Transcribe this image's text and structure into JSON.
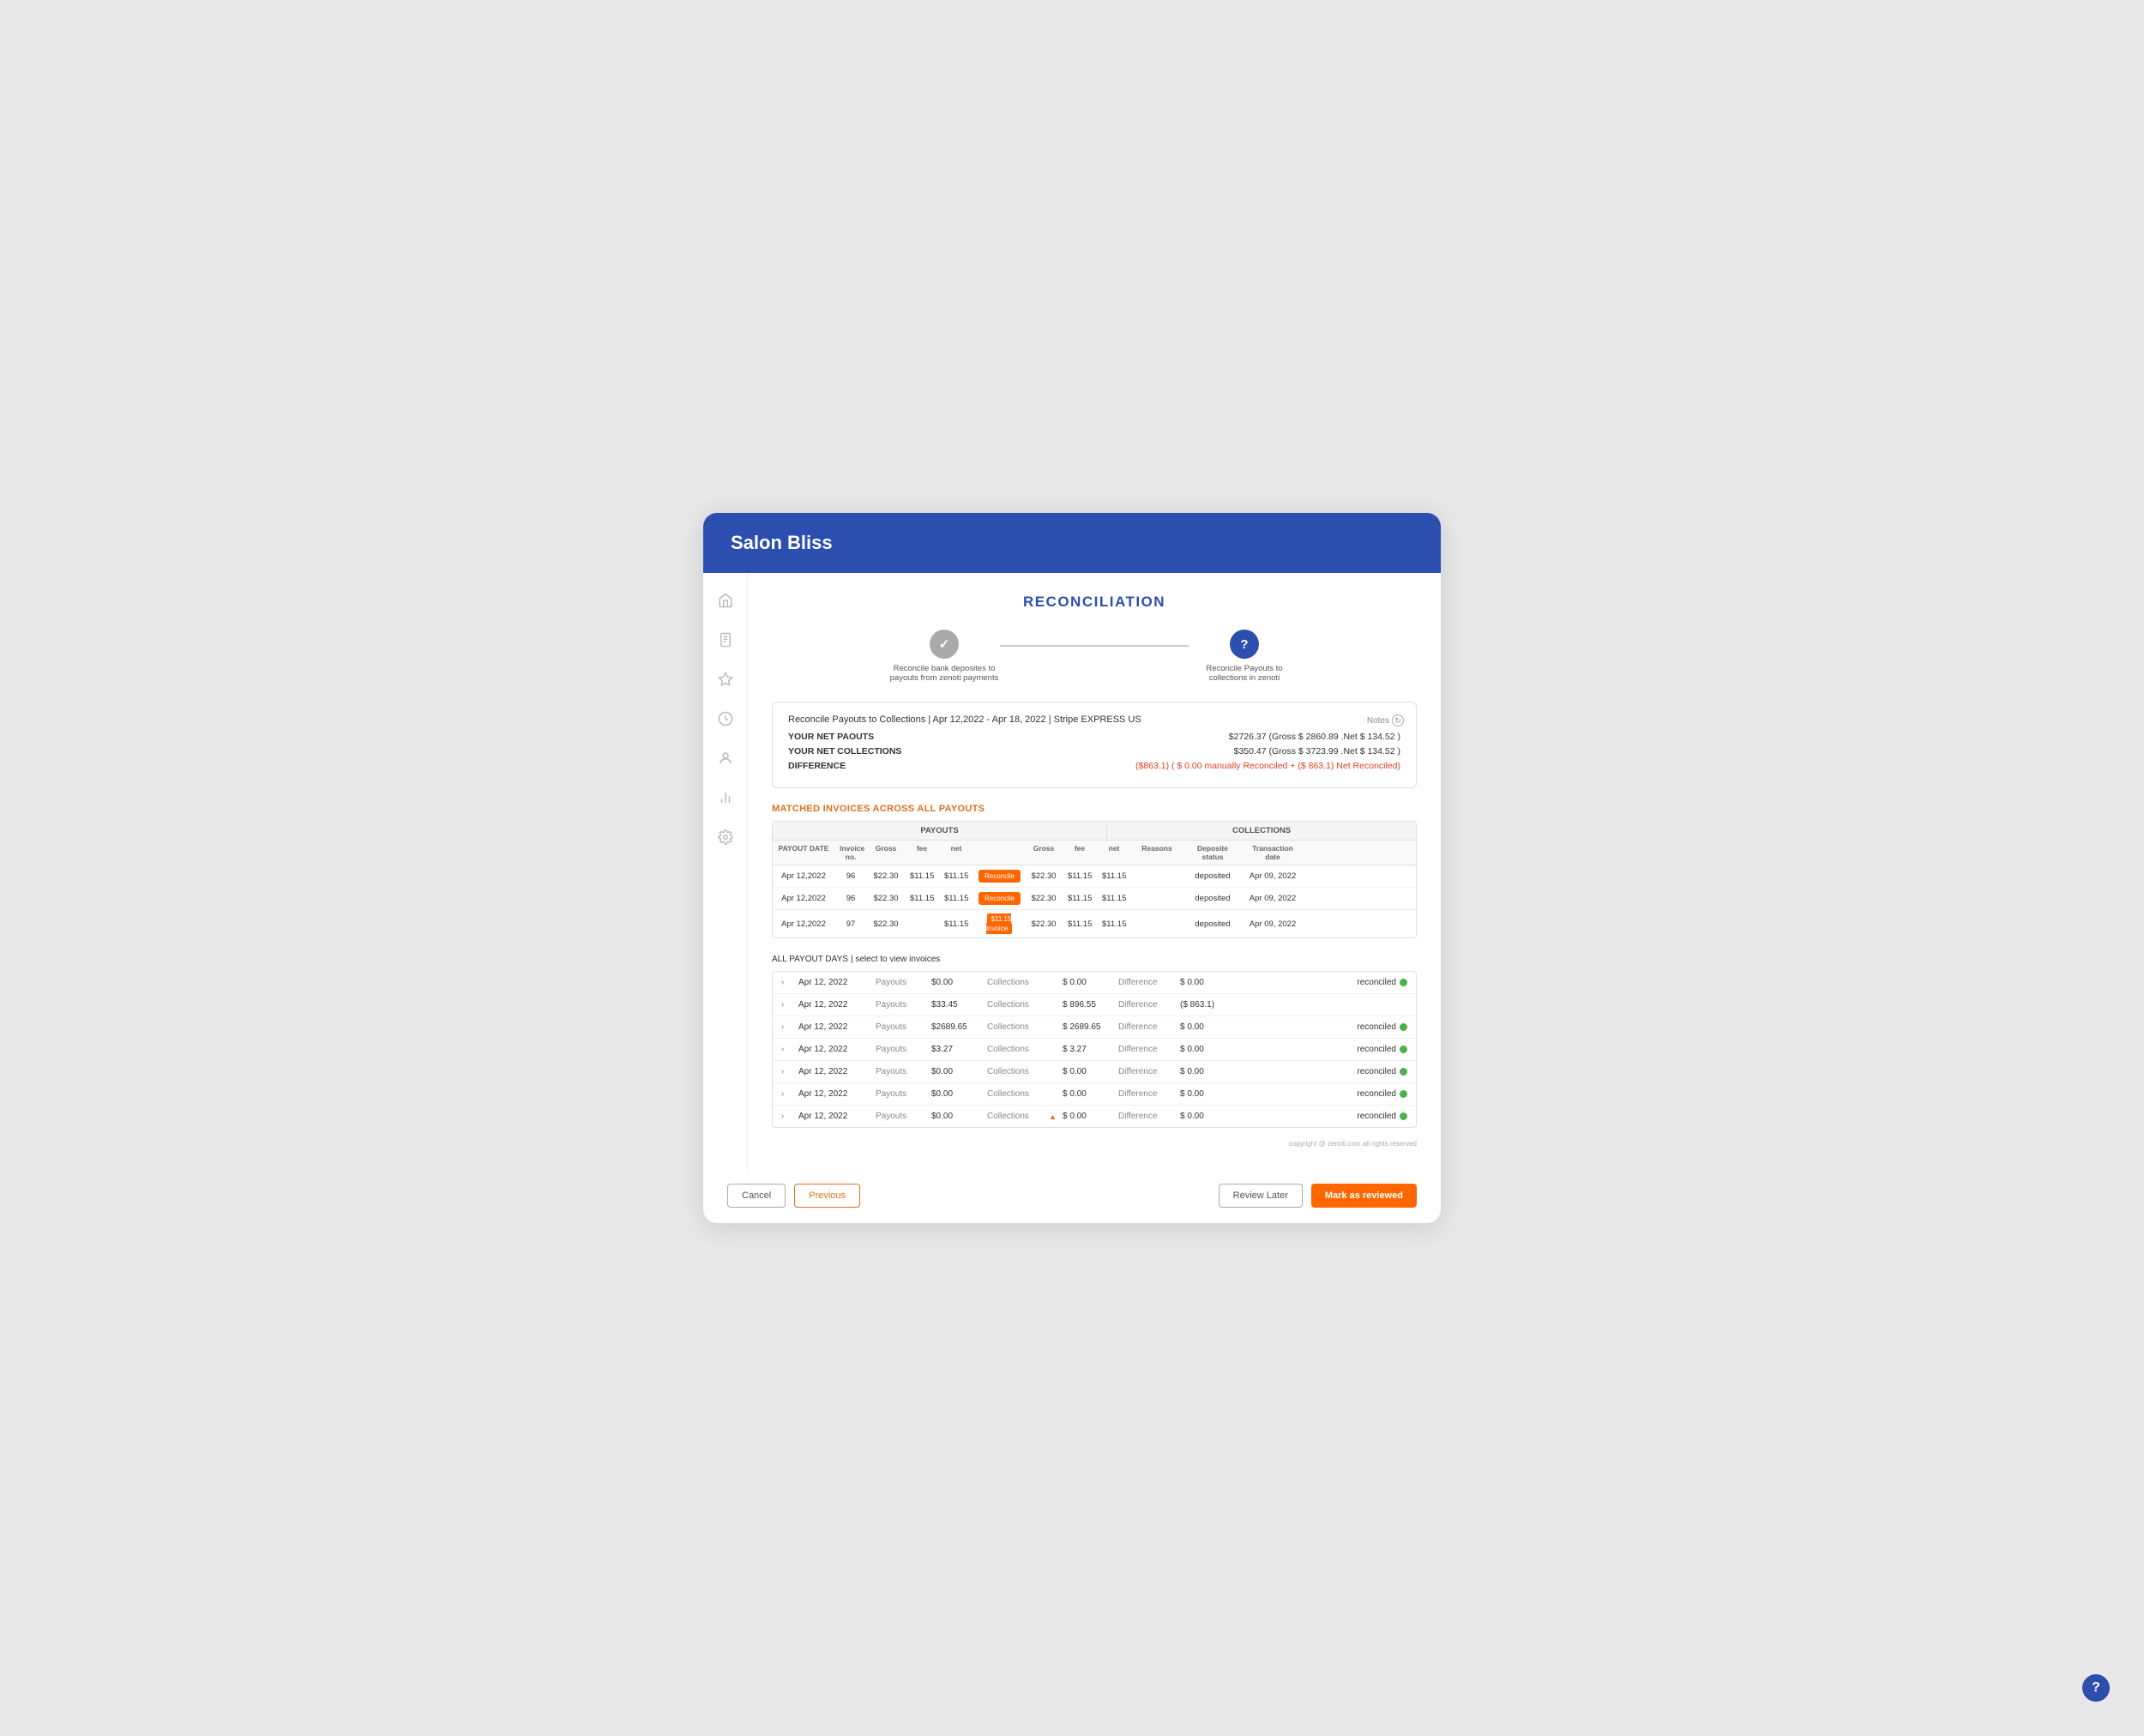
{
  "app": {
    "brand": "Salon Bliss",
    "page_title": "RECONCILIATION"
  },
  "sidebar": {
    "icons": [
      "home",
      "document",
      "star",
      "clock",
      "user",
      "chart",
      "gear"
    ]
  },
  "steps": [
    {
      "id": "step1",
      "state": "done",
      "symbol": "✓",
      "label": "Reconcile bank deposites to payouts from zenoti payments"
    },
    {
      "id": "step2",
      "state": "active",
      "symbol": "?",
      "label": "Reconcile Payouts to collections in zenoti"
    }
  ],
  "summary": {
    "title": "Reconcile Payouts to Collections | Apr 12,2022 - Apr 18, 2022 | Stripe EXPRESS US",
    "net_payouts_label": "YOUR NET PAOUTS",
    "net_payouts_value": "$2726.37 (Gross $ 2860.89 .Net $ 134.52 )",
    "net_collections_label": "YOUR NET COLLECTIONS",
    "net_collections_value": "$350.47 (Gross $ 3723.99 .Net $ 134.52 )",
    "difference_label": "DIFFERENCE",
    "difference_value": "($863.1) ( $ 0.00 manually Reconciled + ($ 863.1) Net Reconciled)",
    "notes_label": "Notes"
  },
  "matched_invoices": {
    "section_label": "MATCHED INVOICES ACROSS ALL PAYOUTS",
    "group_headers": [
      "PAYOUTS",
      "COLLECTIONS"
    ],
    "col_headers": [
      "PAYOUT DATE",
      "Invoice no.",
      "Gross",
      "fee",
      "net",
      "",
      "Gross",
      "fee",
      "net",
      "Reasons",
      "Deposite status",
      "Transaction date"
    ],
    "rows": [
      {
        "payout_date": "Apr 12,2022",
        "invoice_no": "96",
        "gross": "$22.30",
        "fee": "$11.15",
        "net": "$11.15",
        "btn": "Reconcile",
        "btn_type": "orange",
        "col_gross": "$22.30",
        "col_fee": "$11.15",
        "col_net": "$11.15",
        "reasons": "",
        "dep_status": "deposited",
        "trans_date": "Apr 09, 2022"
      },
      {
        "payout_date": "Apr 12,2022",
        "invoice_no": "96",
        "gross": "$22.30",
        "fee": "$11.15",
        "net": "$11.15",
        "btn": "Reconcile",
        "btn_type": "orange",
        "col_gross": "$22.30",
        "col_fee": "$11.15",
        "col_net": "$11.15",
        "reasons": "",
        "dep_status": "deposited",
        "trans_date": "Apr 09, 2022"
      },
      {
        "payout_date": "Apr 12,2022",
        "invoice_no": "97",
        "gross": "$22.30",
        "fee": "",
        "net": "$11.15",
        "btn": "$11.15 Invoice",
        "btn_type": "badge",
        "col_gross": "$22.30",
        "col_fee": "$11.15",
        "col_net": "$11.15",
        "reasons": "",
        "dep_status": "deposited",
        "trans_date": "Apr 09, 2022"
      }
    ]
  },
  "payout_days": {
    "section_label": "ALL PAYOUT DAYS",
    "section_sub": "| select to view invoices",
    "rows": [
      {
        "date": "Apr 12, 2022",
        "payouts_label": "Payouts",
        "payouts_val": "$0.00",
        "collections_label": "Collections",
        "flag": "",
        "collections_val": "$ 0.00",
        "diff_label": "Difference",
        "diff_val": "$ 0.00",
        "status": "reconciled",
        "reconciled": true
      },
      {
        "date": "Apr 12, 2022",
        "payouts_label": "Payouts",
        "payouts_val": "$33.45",
        "collections_label": "Collections",
        "flag": "",
        "collections_val": "$ 896.55",
        "diff_label": "Difference",
        "diff_val": "($ 863.1)",
        "status": "",
        "reconciled": false
      },
      {
        "date": "Apr 12, 2022",
        "payouts_label": "Payouts",
        "payouts_val": "$2689.65",
        "collections_label": "Collections",
        "flag": "",
        "collections_val": "$ 2689.65",
        "diff_label": "Difference",
        "diff_val": "$ 0.00",
        "status": "reconciled",
        "reconciled": true
      },
      {
        "date": "Apr 12, 2022",
        "payouts_label": "Payouts",
        "payouts_val": "$3.27",
        "collections_label": "Collections",
        "flag": "",
        "collections_val": "$ 3.27",
        "diff_label": "Difference",
        "diff_val": "$ 0.00",
        "status": "reconciled",
        "reconciled": true
      },
      {
        "date": "Apr 12, 2022",
        "payouts_label": "Payouts",
        "payouts_val": "$0.00",
        "collections_label": "Collections",
        "flag": "",
        "collections_val": "$ 0.00",
        "diff_label": "Difference",
        "diff_val": "$ 0.00",
        "status": "reconciled",
        "reconciled": true
      },
      {
        "date": "Apr 12, 2022",
        "payouts_label": "Payouts",
        "payouts_val": "$0.00",
        "collections_label": "Collections",
        "flag": "",
        "collections_val": "$ 0.00",
        "diff_label": "Difference",
        "diff_val": "$ 0.00",
        "status": "reconciled",
        "reconciled": true
      },
      {
        "date": "Apr 12, 2022",
        "payouts_label": "Payouts",
        "payouts_val": "$0.00",
        "collections_label": "Collections",
        "flag": "▲",
        "collections_val": "$ 0.00",
        "diff_label": "Difference",
        "diff_val": "$ 0.00",
        "status": "reconciled",
        "reconciled": true
      }
    ]
  },
  "footer": {
    "cancel_label": "Cancel",
    "previous_label": "Previous",
    "review_later_label": "Review Later",
    "mark_reviewed_label": "Mark as reviewed"
  },
  "copyright": "copyright @ zenoti.com all rights reserved",
  "help_btn_label": "?"
}
